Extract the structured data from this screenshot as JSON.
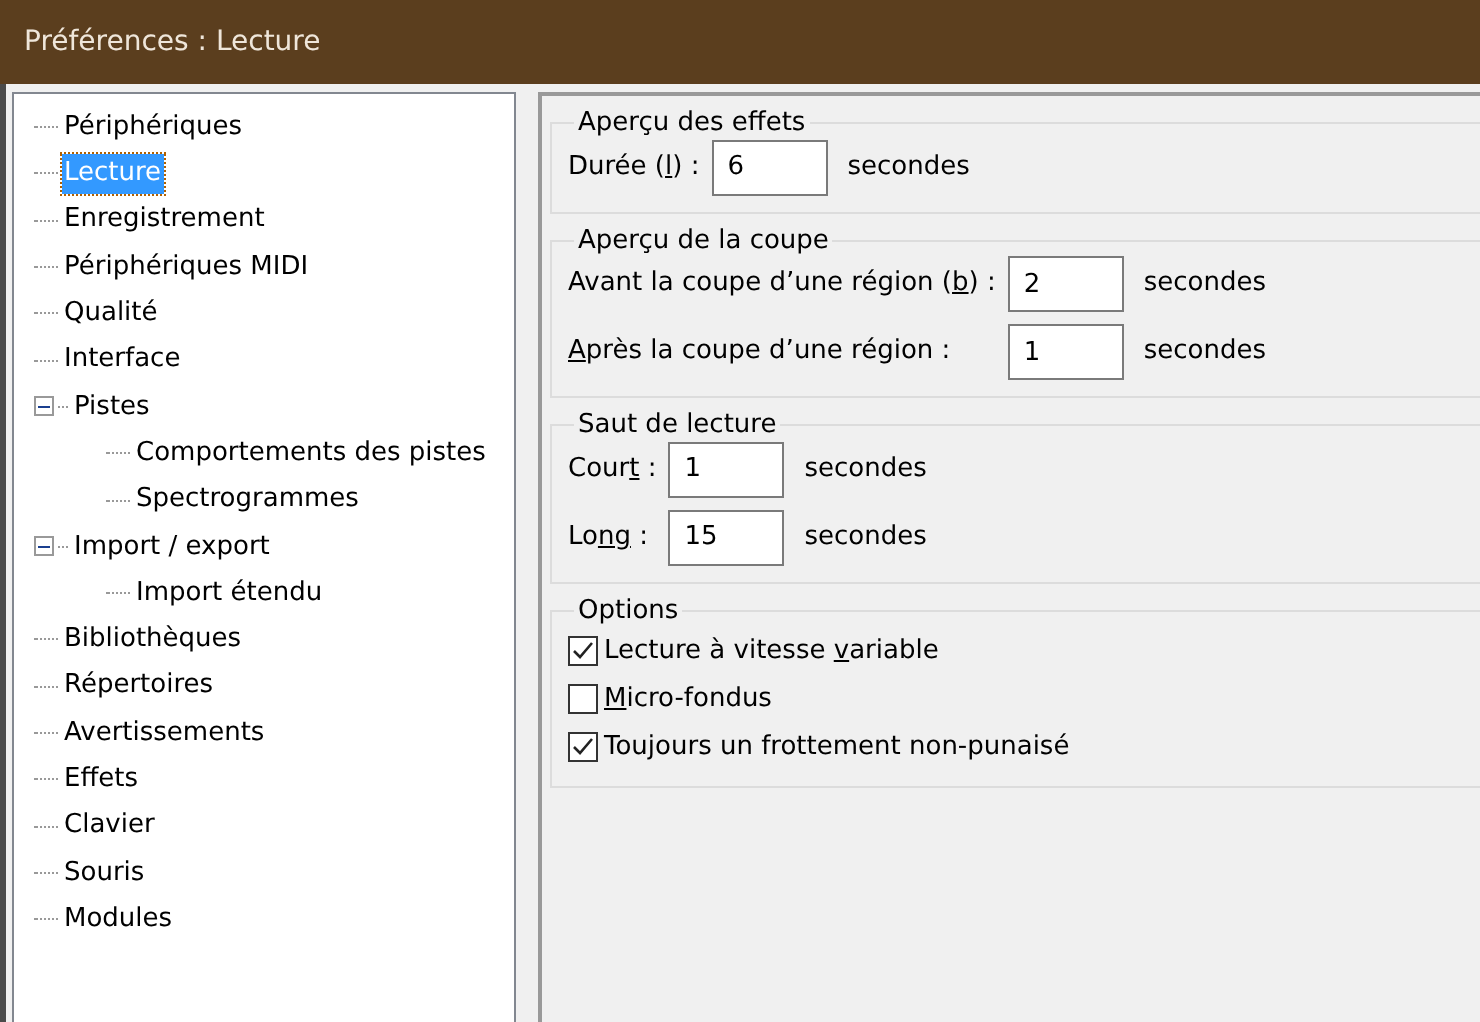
{
  "window": {
    "title": "Préférences : Lecture"
  },
  "sidebar": {
    "items": [
      {
        "label": "Périphériques",
        "selected": false
      },
      {
        "label": "Lecture",
        "selected": true
      },
      {
        "label": "Enregistrement",
        "selected": false
      },
      {
        "label": "Périphériques MIDI",
        "selected": false
      },
      {
        "label": "Qualité",
        "selected": false
      },
      {
        "label": "Interface",
        "selected": false
      },
      {
        "label": "Pistes",
        "selected": false,
        "expanded": true,
        "children": [
          {
            "label": "Comportements des pistes",
            "selected": false
          },
          {
            "label": "Spectrogrammes",
            "selected": false
          }
        ]
      },
      {
        "label": "Import / export",
        "selected": false,
        "expanded": true,
        "children": [
          {
            "label": "Import étendu",
            "selected": false
          }
        ]
      },
      {
        "label": "Bibliothèques",
        "selected": false
      },
      {
        "label": "Répertoires",
        "selected": false
      },
      {
        "label": "Avertissements",
        "selected": false
      },
      {
        "label": "Effets",
        "selected": false
      },
      {
        "label": "Clavier",
        "selected": false
      },
      {
        "label": "Souris",
        "selected": false
      },
      {
        "label": "Modules",
        "selected": false
      }
    ]
  },
  "groups": [
    {
      "title": "Aperçu des effets",
      "kind": "fields",
      "rows": [
        {
          "label": [
            {
              "text": "Durée (",
              "underlined": false
            },
            {
              "text": "l",
              "underlined": true
            },
            {
              "text": ") :",
              "underlined": false
            }
          ],
          "value": "6",
          "unit": "secondes"
        }
      ]
    },
    {
      "title": "Aperçu de la coupe",
      "kind": "fields",
      "rows": [
        {
          "label": [
            {
              "text": "Avant la coupe d’une région (",
              "underlined": false
            },
            {
              "text": "b",
              "underlined": true
            },
            {
              "text": ") :",
              "underlined": false
            }
          ],
          "value": "2",
          "unit": "secondes"
        },
        {
          "label": [
            {
              "text": "A",
              "underlined": true
            },
            {
              "text": "près la coupe d’une région :",
              "underlined": false
            }
          ],
          "value": "1",
          "unit": "secondes"
        }
      ]
    },
    {
      "title": "Saut de lecture",
      "kind": "fields",
      "rows": [
        {
          "label": [
            {
              "text": "Cour",
              "underlined": false
            },
            {
              "text": "t",
              "underlined": true
            },
            {
              "text": " :",
              "underlined": false
            }
          ],
          "value": "1",
          "unit": "secondes"
        },
        {
          "label": [
            {
              "text": "Lo",
              "underlined": false
            },
            {
              "text": "ng",
              "underlined": true
            },
            {
              "text": " :",
              "underlined": false
            }
          ],
          "value": "15",
          "unit": "secondes"
        }
      ]
    },
    {
      "title": "Options",
      "kind": "checks",
      "items": [
        {
          "label": [
            {
              "text": "Lecture à vitesse ",
              "underlined": false
            },
            {
              "text": "v",
              "underlined": true
            },
            {
              "text": "ariable",
              "underlined": false
            }
          ],
          "checked": true
        },
        {
          "label": [
            {
              "text": "M",
              "underlined": true
            },
            {
              "text": "icro-fondus",
              "underlined": false
            }
          ],
          "checked": false
        },
        {
          "label": [
            {
              "text": "Toujours un frottement non-punaisé",
              "underlined": false
            }
          ],
          "checked": true
        }
      ]
    }
  ]
}
